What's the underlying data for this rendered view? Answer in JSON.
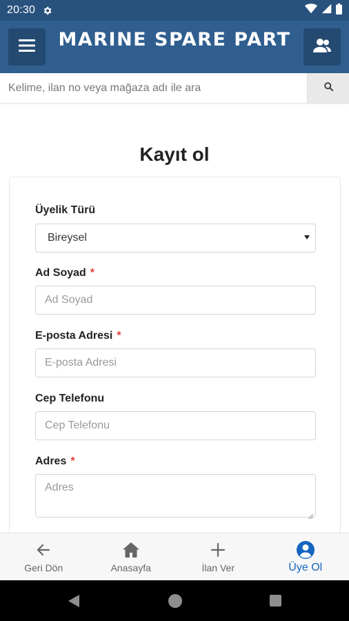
{
  "status_bar": {
    "time": "20:30",
    "icons": [
      "settings-icon",
      "wifi-icon",
      "signal-icon",
      "battery-icon"
    ]
  },
  "header": {
    "title": "MARINE SPARE PART",
    "menu_icon": "hamburger-icon",
    "user_icon": "users-icon"
  },
  "search": {
    "placeholder": "Kelime, ilan no veya mağaza adı ile ara",
    "button_icon": "search-icon"
  },
  "page": {
    "title": "Kayıt ol"
  },
  "form": {
    "membership": {
      "label": "Üyelik Türü",
      "selected": "Bireysel"
    },
    "name": {
      "label": "Ad Soyad",
      "required_mark": "*",
      "placeholder": "Ad Soyad"
    },
    "email": {
      "label": "E-posta Adresi",
      "required_mark": "*",
      "placeholder": "E-posta Adresi"
    },
    "phone": {
      "label": "Cep Telefonu",
      "placeholder": "Cep Telefonu"
    },
    "address": {
      "label": "Adres",
      "required_mark": "*",
      "placeholder": "Adres"
    }
  },
  "bottom_nav": {
    "items": [
      {
        "label": "Geri Dön",
        "icon": "arrow-left-icon",
        "active": false
      },
      {
        "label": "Anasayfa",
        "icon": "home-icon",
        "active": false
      },
      {
        "label": "İlan Ver",
        "icon": "plus-icon",
        "active": false
      },
      {
        "label": "Üye Ol",
        "icon": "user-circle-icon",
        "active": true
      }
    ]
  },
  "colors": {
    "status_bar": "#28527d",
    "header": "#2f5e8f",
    "header_button": "#244a72",
    "active_nav": "#1565c0",
    "required": "#e53935"
  }
}
